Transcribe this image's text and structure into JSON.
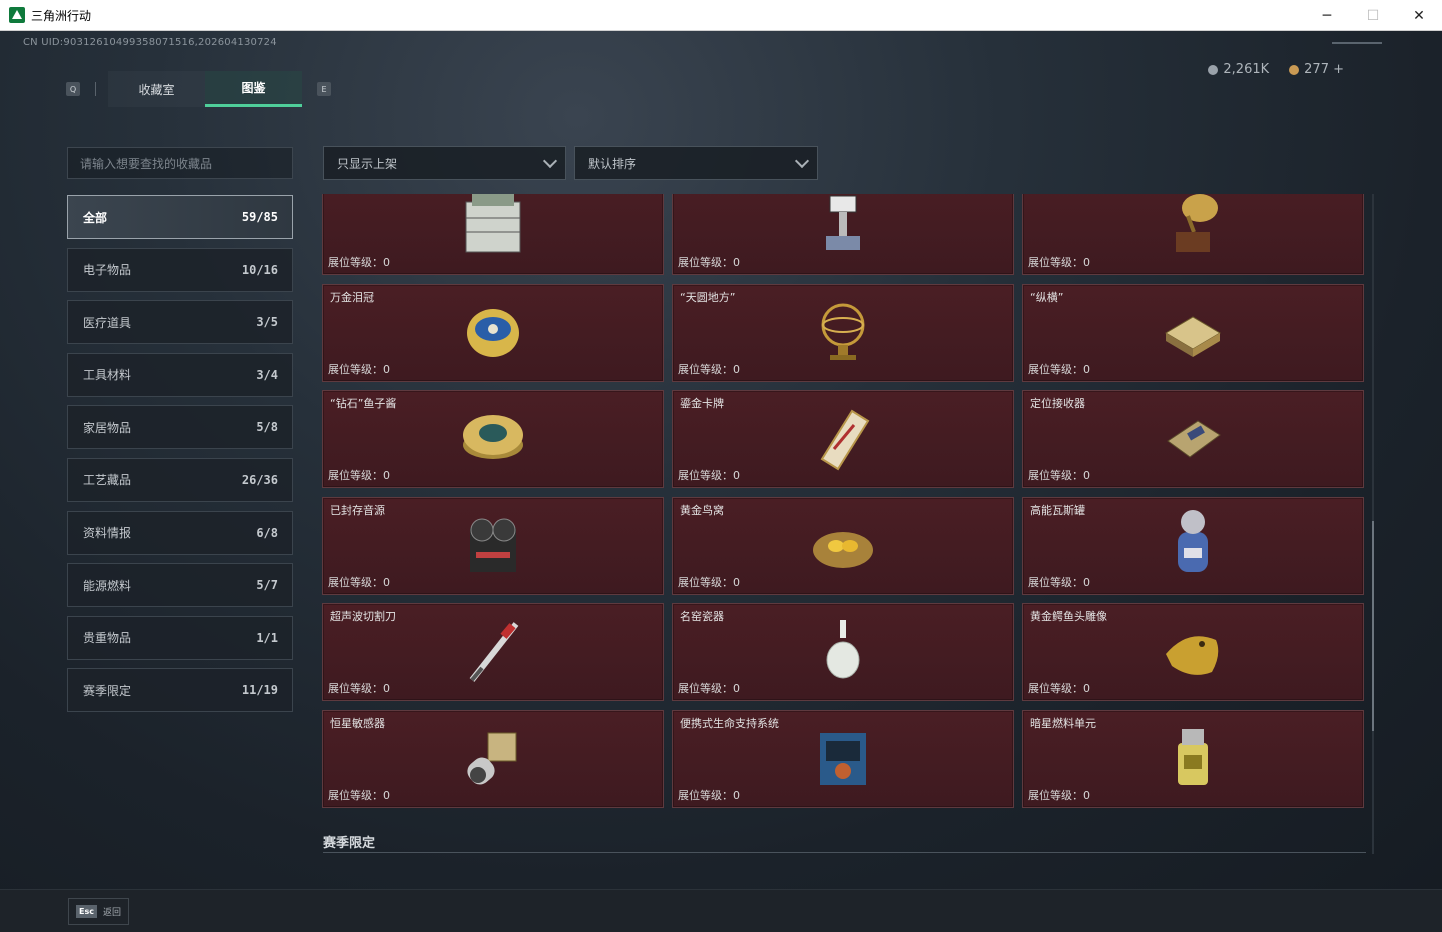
{
  "window": {
    "title": "三角洲行动",
    "minimize": "─",
    "maximize": "☐",
    "close": "✕"
  },
  "header": {
    "uid": "CN UID:9031261049935807151​6,202604130724",
    "currency": [
      {
        "amount": "2,261K",
        "color": "#9aa2aa"
      },
      {
        "amount": "277 +",
        "color": "#c99a54"
      }
    ]
  },
  "tabs": {
    "left_key": "Q",
    "right_key": "E",
    "items": [
      {
        "label": "收藏室",
        "active": false
      },
      {
        "label": "图鉴",
        "active": true
      }
    ]
  },
  "sidebar": {
    "search_placeholder": "请输入想要查找的收藏品",
    "categories": [
      {
        "label": "全部",
        "count": "59/85",
        "active": true
      },
      {
        "label": "电子物品",
        "count": "10/16"
      },
      {
        "label": "医疗道具",
        "count": "3/5"
      },
      {
        "label": "工具材料",
        "count": "3/4"
      },
      {
        "label": "家居物品",
        "count": "5/8"
      },
      {
        "label": "工艺藏品",
        "count": "26/36"
      },
      {
        "label": "资料情报",
        "count": "6/8"
      },
      {
        "label": "能源燃料",
        "count": "5/7"
      },
      {
        "label": "贵重物品",
        "count": "1/1"
      },
      {
        "label": "赛季限定",
        "count": "11/19"
      }
    ]
  },
  "filters": {
    "display": "只显示上架",
    "sort": "默认排序"
  },
  "level_label": "展位等级：",
  "items": [
    {
      "name": "",
      "level": "0",
      "icon": "battery-case-icon"
    },
    {
      "name": "",
      "level": "0",
      "icon": "robot-arm-icon"
    },
    {
      "name": "",
      "level": "0",
      "icon": "gramophone-icon"
    },
    {
      "name": "万金泪冠",
      "level": "0",
      "icon": "jeweled-egg-icon"
    },
    {
      "name": "“天圆地方”",
      "level": "0",
      "icon": "armillary-sphere-icon"
    },
    {
      "name": "“纵横”",
      "level": "0",
      "icon": "chessboard-icon"
    },
    {
      "name": "“钻石”鱼子酱",
      "level": "0",
      "icon": "caviar-tin-icon"
    },
    {
      "name": "鎏金卡牌",
      "level": "0",
      "icon": "gold-card-icon"
    },
    {
      "name": "定位接收器",
      "level": "0",
      "icon": "receiver-icon"
    },
    {
      "name": "已封存音源",
      "level": "0",
      "icon": "reel-recorder-icon"
    },
    {
      "name": "黄金鸟窝",
      "level": "0",
      "icon": "golden-nest-icon"
    },
    {
      "name": "高能瓦斯罐",
      "level": "0",
      "icon": "gas-tank-icon"
    },
    {
      "name": "超声波切割刀",
      "level": "0",
      "icon": "ultrasonic-knife-icon"
    },
    {
      "name": "名窑瓷器",
      "level": "0",
      "icon": "porcelain-vase-icon"
    },
    {
      "name": "黄金鳄鱼头雕像",
      "level": "0",
      "icon": "gold-crocodile-icon"
    },
    {
      "name": "恒星敏感器",
      "level": "0",
      "icon": "star-sensor-icon"
    },
    {
      "name": "便携式生命支持系统",
      "level": "0",
      "icon": "life-support-icon"
    },
    {
      "name": "暗星燃料单元",
      "level": "0",
      "icon": "fuel-cell-icon"
    }
  ],
  "next_section": "赛季限定",
  "footer": {
    "esc_key": "Esc",
    "esc_label": "返回"
  }
}
